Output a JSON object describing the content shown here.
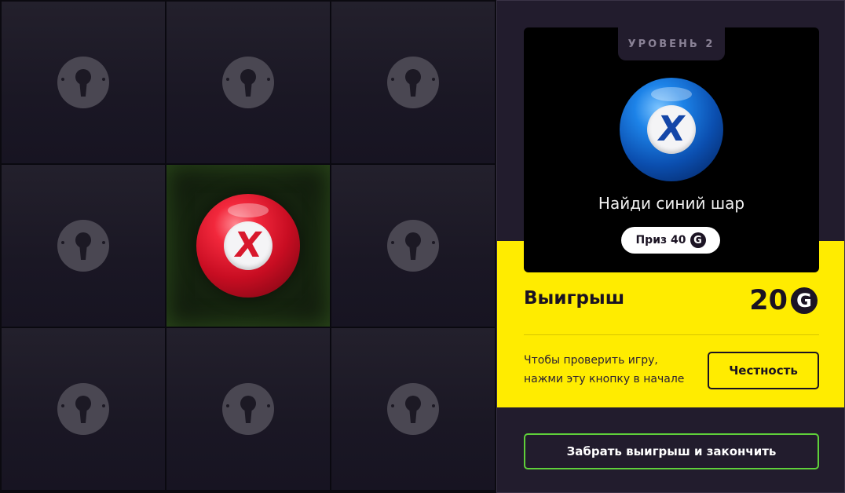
{
  "grid": {
    "cells": [
      {
        "state": "locked",
        "icon": "keyhole-icon"
      },
      {
        "state": "locked",
        "icon": "keyhole-icon"
      },
      {
        "state": "locked",
        "icon": "keyhole-icon"
      },
      {
        "state": "locked",
        "icon": "keyhole-icon"
      },
      {
        "state": "opened",
        "icon": "red-ball-icon",
        "mark": "X"
      },
      {
        "state": "locked",
        "icon": "keyhole-icon"
      },
      {
        "state": "locked",
        "icon": "keyhole-icon"
      },
      {
        "state": "locked",
        "icon": "keyhole-icon"
      },
      {
        "state": "locked",
        "icon": "keyhole-icon"
      }
    ]
  },
  "panel": {
    "level_label": "УРОВЕНЬ 2",
    "target_ball": {
      "icon": "blue-ball-icon",
      "mark": "X"
    },
    "task_text": "Найди синий шар",
    "prize_label": "Приз 40",
    "currency_symbol": "G",
    "win_label": "Выигрыш",
    "win_value": "20",
    "hint_text": "Чтобы проверить игру, нажми эту кнопку в начале",
    "fairness_button": "Честность",
    "cashout_button": "Забрать выигрыш и закончить"
  },
  "colors": {
    "accent_yellow": "#ffec00",
    "cashout_border": "#5fd03a",
    "panel_bg": "#221c2d",
    "red_ball": "#e0192e",
    "blue_ball": "#1470d8"
  }
}
